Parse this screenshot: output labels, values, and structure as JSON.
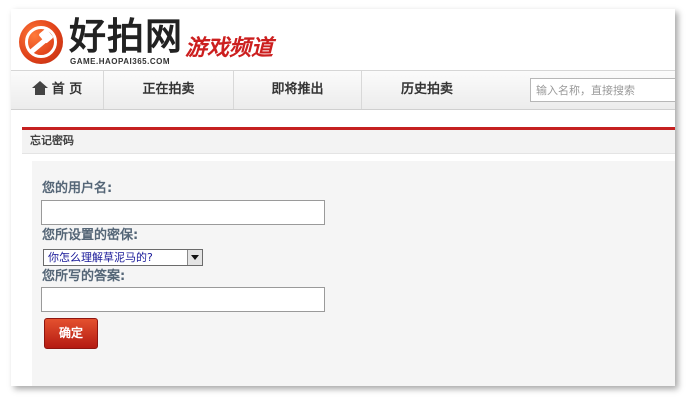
{
  "brand": {
    "name": "好拍网",
    "domain_text": "GAME.HAOPAI365.COM",
    "channel": "游戏频道"
  },
  "nav": {
    "items": [
      {
        "label": "首 页"
      },
      {
        "label": "正在拍卖"
      },
      {
        "label": "即将推出"
      },
      {
        "label": "历史拍卖"
      }
    ],
    "search_placeholder": "输入名称，直接搜索"
  },
  "panel": {
    "title": "忘记密码"
  },
  "form": {
    "username_label": "您的用户名:",
    "username_value": "",
    "question_label": "您所设置的密保:",
    "question_selected": "你怎么理解草泥马的?",
    "answer_label": "您所写的答案:",
    "answer_value": "",
    "submit_label": "确定"
  },
  "colors": {
    "accent_red": "#c52020",
    "label_text": "#556677",
    "button_red": "#b41a12"
  },
  "icons": [
    "home-icon",
    "dropdown-arrow-icon",
    "logo-hammer-icon"
  ]
}
